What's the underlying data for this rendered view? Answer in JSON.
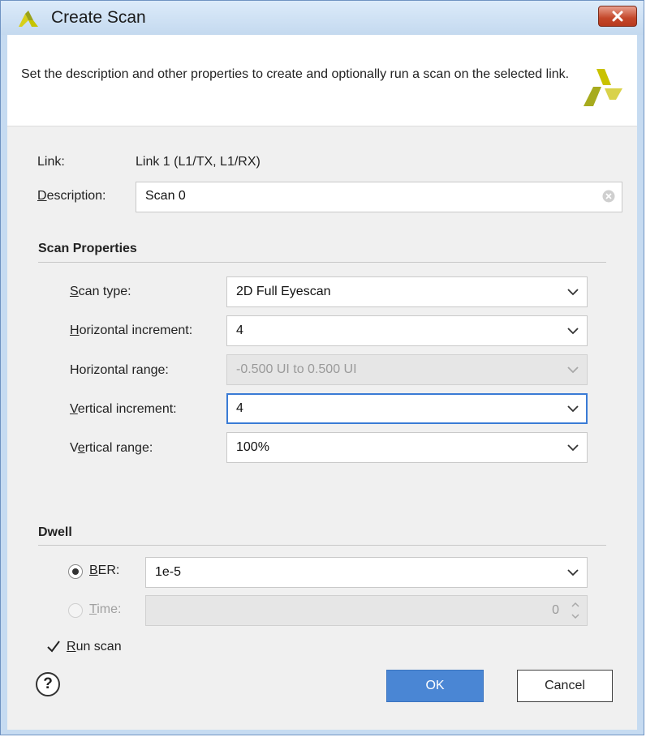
{
  "window": {
    "title": "Create Scan"
  },
  "banner": {
    "text": "Set the description and other properties to create and optionally run a scan on the selected link."
  },
  "link": {
    "label": "Link:",
    "value": "Link 1 (L1/TX, L1/RX)"
  },
  "description": {
    "label_mnemonic": "D",
    "label_rest": "escription:",
    "value": "Scan 0"
  },
  "scan_properties": {
    "title": "Scan Properties",
    "scan_type": {
      "label_mnemonic": "S",
      "label_rest": "can type:",
      "value": "2D Full Eyescan"
    },
    "horizontal_increment": {
      "label_mnemonic": "H",
      "label_rest": "orizontal increment:",
      "value": "4"
    },
    "horizontal_range": {
      "label": "Horizontal range:",
      "value": "-0.500 UI to 0.500 UI"
    },
    "vertical_increment": {
      "label_mnemonic": "V",
      "label_rest": "ertical increment:",
      "value": "4"
    },
    "vertical_range": {
      "label_pre": "V",
      "label_mnemonic": "e",
      "label_rest": "rtical range:",
      "value": "100%"
    }
  },
  "dwell": {
    "title": "Dwell",
    "ber": {
      "label_mnemonic": "B",
      "label_rest": "ER:",
      "value": "1e-5",
      "selected": true
    },
    "time": {
      "label_mnemonic": "T",
      "label_rest": "ime:",
      "value": "0",
      "selected": false
    }
  },
  "run_scan": {
    "label_mnemonic": "R",
    "label_rest": "un scan",
    "checked": true
  },
  "buttons": {
    "help": "?",
    "ok": "OK",
    "cancel": "Cancel"
  },
  "colors": {
    "accent": "#4a86d4",
    "focus_border": "#3a7bd5",
    "logo": "#c9c200",
    "close_button": "#c4472a"
  },
  "icons": {
    "title_logo": "xilinx-logo-icon",
    "banner_logo": "xilinx-logo-icon",
    "close": "close-icon",
    "clear": "clear-icon"
  }
}
